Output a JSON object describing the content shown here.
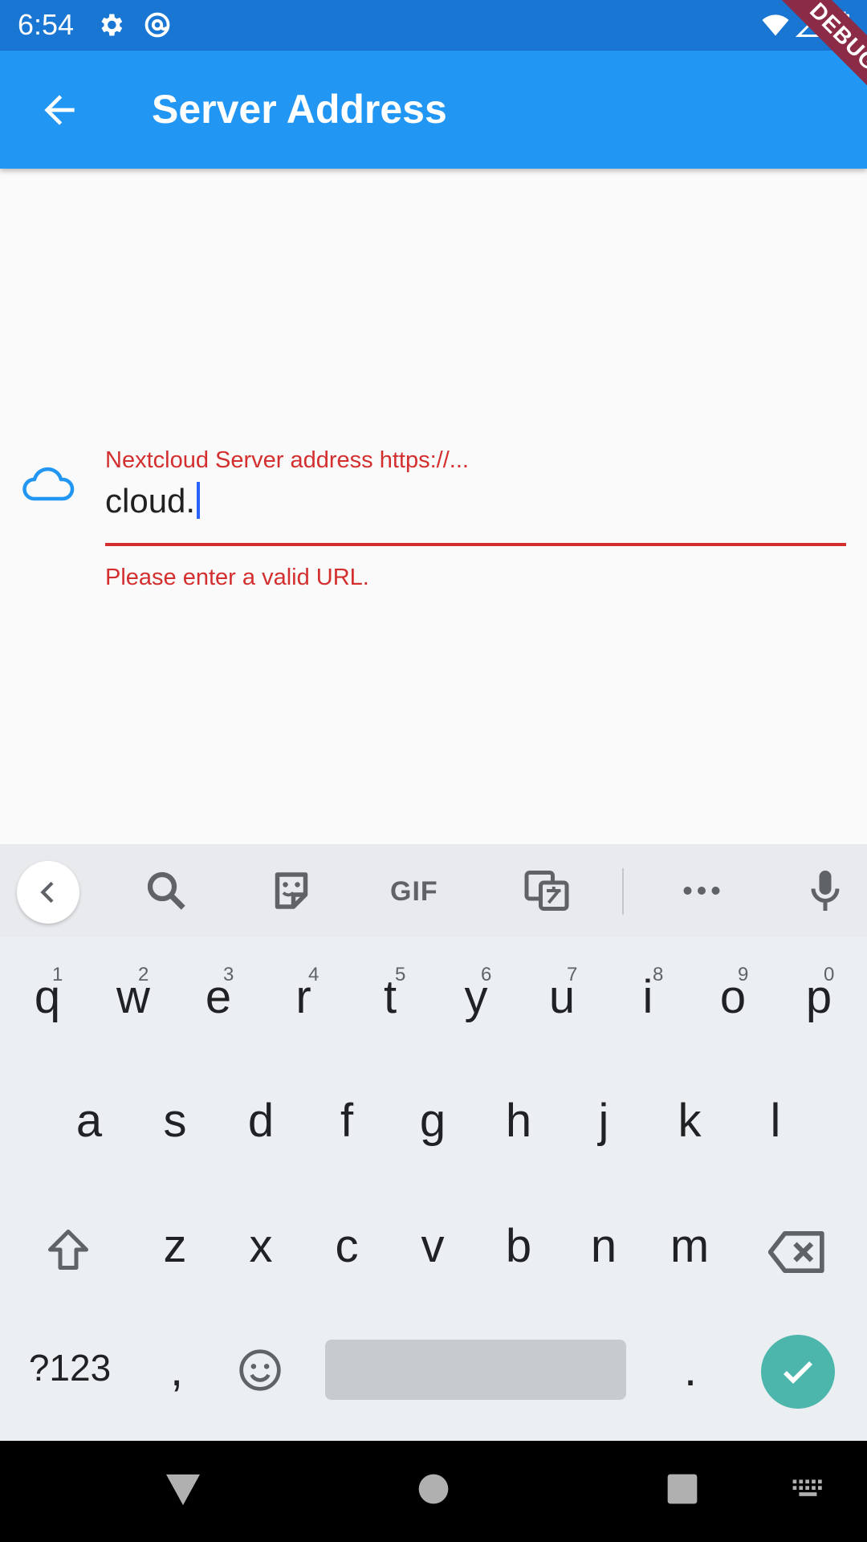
{
  "status_bar": {
    "time": "6:54"
  },
  "app_bar": {
    "title": "Server Address"
  },
  "debug_banner": "DEBUG",
  "form": {
    "label": "Nextcloud Server address https://...",
    "value": "cloud.",
    "error": "Please enter a valid URL."
  },
  "keyboard": {
    "toolbar_gif": "GIF",
    "row1": [
      {
        "key": "q",
        "hint": "1"
      },
      {
        "key": "w",
        "hint": "2"
      },
      {
        "key": "e",
        "hint": "3"
      },
      {
        "key": "r",
        "hint": "4"
      },
      {
        "key": "t",
        "hint": "5"
      },
      {
        "key": "y",
        "hint": "6"
      },
      {
        "key": "u",
        "hint": "7"
      },
      {
        "key": "i",
        "hint": "8"
      },
      {
        "key": "o",
        "hint": "9"
      },
      {
        "key": "p",
        "hint": "0"
      }
    ],
    "row2": [
      "a",
      "s",
      "d",
      "f",
      "g",
      "h",
      "j",
      "k",
      "l"
    ],
    "row3": [
      "z",
      "x",
      "c",
      "v",
      "b",
      "n",
      "m"
    ],
    "symbols_key": "?123",
    "comma_key": ",",
    "period_key": "."
  },
  "colors": {
    "status_bar": "#1976d2",
    "app_bar": "#2196f3",
    "error": "#d32f2f",
    "enter_key": "#4db6ac"
  }
}
